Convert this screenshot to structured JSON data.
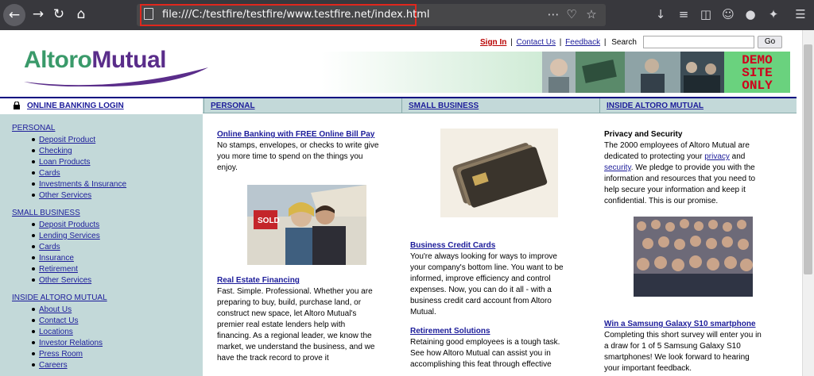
{
  "browser": {
    "url": "file:///C:/testfire/testfire/www.testfire.net/index.html"
  },
  "header": {
    "sign_in": "Sign In",
    "sep": "|",
    "contact": "Contact Us",
    "feedback": "Feedback",
    "search_label": "Search",
    "go": "Go"
  },
  "logo": {
    "part1": "Altoro",
    "part2": "Mutual"
  },
  "banner": {
    "demo": "DEMO SITE ONLY"
  },
  "nav": {
    "login": "ONLINE BANKING LOGIN",
    "personal": "PERSONAL",
    "small_business": "SMALL BUSINESS",
    "inside": "INSIDE ALTORO MUTUAL"
  },
  "sidebar": {
    "personal": {
      "heading": "PERSONAL",
      "items": [
        "Deposit Product",
        "Checking",
        "Loan Products",
        "Cards",
        "Investments & Insurance",
        "Other Services"
      ]
    },
    "small_business": {
      "heading": "SMALL BUSINESS",
      "items": [
        "Deposit Products",
        "Lending Services",
        "Cards",
        "Insurance",
        "Retirement",
        "Other Services"
      ]
    },
    "inside": {
      "heading": "INSIDE ALTORO MUTUAL",
      "items": [
        "About Us",
        "Contact Us",
        "Locations",
        "Investor Relations",
        "Press Room",
        "Careers"
      ]
    }
  },
  "col1": {
    "t1": "Online Banking with FREE Online Bill Pay",
    "p1": [
      "No stamps, envelopes, or checks to write give",
      "you more time to spend on the things you",
      "enjoy."
    ],
    "t2": "Real Estate Financing",
    "p2": [
      "Fast. Simple. Professional. Whether you are",
      "preparing to buy, build, purchase land, or",
      "construct new space, let Altoro Mutual's",
      "premier real estate lenders help with",
      "financing. As a regional leader, we know the",
      "market, we understand the business, and we",
      "have the track record to prove it"
    ],
    "sold": "SOLD"
  },
  "col2": {
    "t1": "Business Credit Cards",
    "p1": [
      "You're always looking for ways to improve",
      "your company's bottom line. You want to be",
      "informed, improve efficiency and control",
      "expenses. Now, you can do it all - with a",
      "business credit card account from Altoro",
      "Mutual."
    ],
    "t2": "Retirement Solutions",
    "p2": [
      "Retaining good employees is a tough task.",
      "See how Altoro Mutual can assist you in",
      "accomplishing this feat through effective"
    ]
  },
  "col3": {
    "t1": "Privacy and Security",
    "p1a": "The 2000 employees of Altoro Mutual are",
    "p1b_pre": "dedicated to protecting your ",
    "privacy": "privacy",
    "p1b_post": " and",
    "security": "security",
    "p1c_post": ". We pledge to provide you with the",
    "p1d": [
      "information and resources that you need to",
      "help secure your information and keep it",
      "confidential. This is our promise."
    ],
    "t2": "Win a Samsung Galaxy S10 smartphone",
    "p2": [
      "Completing this short survey will enter you in",
      "a draw for 1 of 5 Samsung Galaxy S10",
      "smartphones! We look forward to hearing",
      "your important feedback."
    ]
  },
  "colors": {
    "link": "#1c1c9a",
    "nav_bg": "#c3d9d9",
    "signin": "#b80000",
    "demo_text": "#d0001c"
  }
}
